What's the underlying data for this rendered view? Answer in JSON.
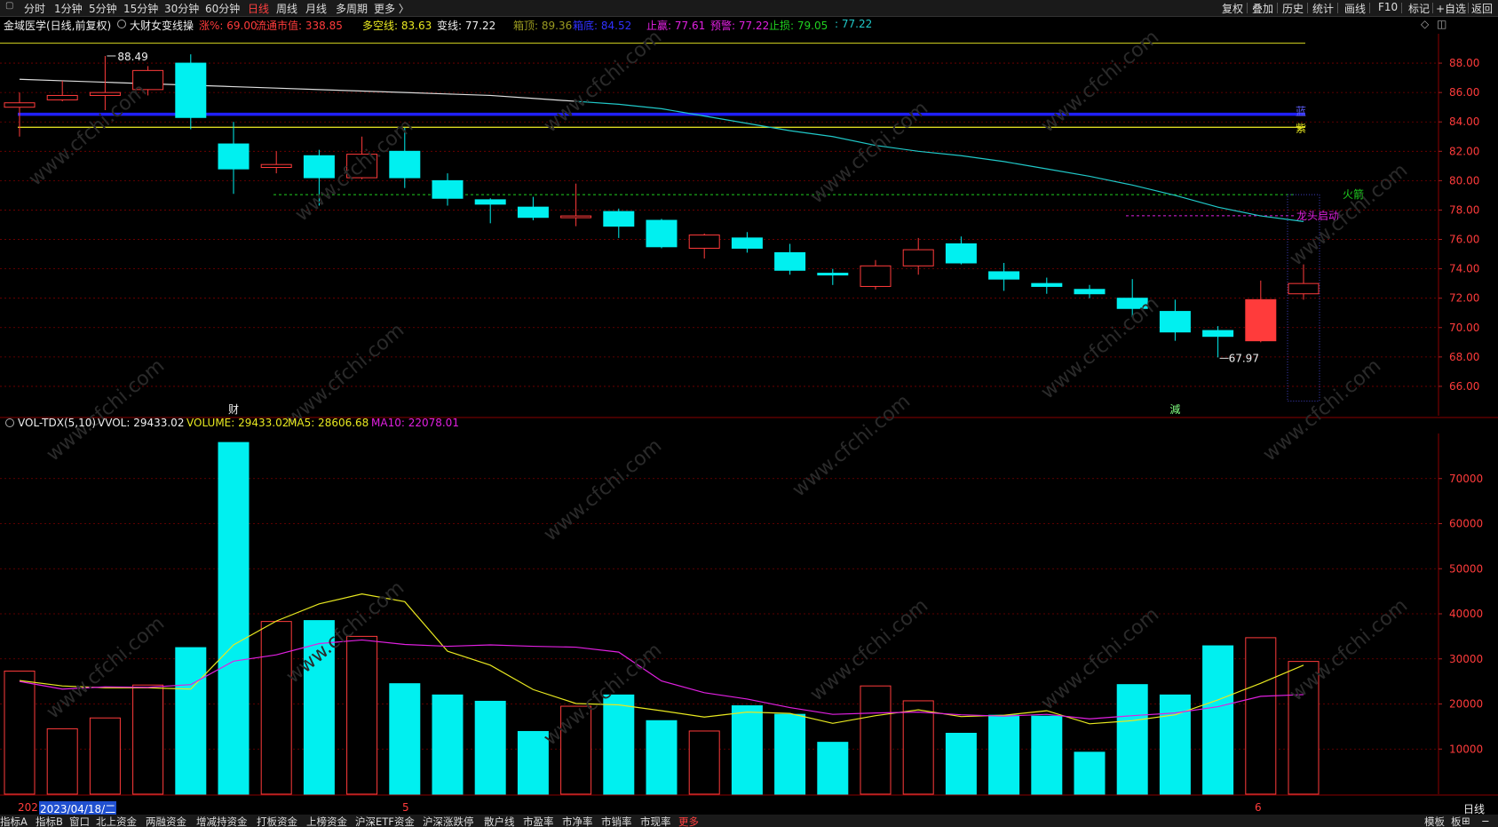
{
  "toolbar": {
    "tabs": [
      "分时",
      "1分钟",
      "5分钟",
      "15分钟",
      "30分钟",
      "60分钟",
      "日线",
      "周线",
      "月线",
      "多周期",
      "更多 〉"
    ],
    "active_tab": "日线",
    "right_buttons": [
      "复权",
      "叠加",
      "历史",
      "统计",
      "画线",
      "F10",
      "标记",
      "+自选",
      "返回"
    ]
  },
  "info": {
    "stock_name": "金域医学(日线,前复权)",
    "indicator_name": "大财女变线操",
    "pct_label": "涨%: 69.00",
    "float_cap_label": "流通市值: 338.85",
    "longshort_label": "多空线: 83.63",
    "change_label": "变线: 77.22",
    "box_top_label": "箱顶: 89.36",
    "box_bottom_label": "箱底: 84.52",
    "stop_profit_label": "止赢: 77.61",
    "warn_label": "预警: 77.22",
    "stop_loss_label": "止损: 79.05",
    "last_label": ": 77.22"
  },
  "colors": {
    "up": "#ff3b3b",
    "down": "#00f0f0",
    "box_bottom_line": "#2020ff",
    "longshort_line": "#d8d820",
    "ma_line": "#20c8c8",
    "ma5": "#e8e820",
    "ma10": "#e020e0",
    "grid_red": "#7a0000",
    "stop_loss_line": "#20d020",
    "warn_line": "#e020e0"
  },
  "price_axis": {
    "min": 64,
    "max": 90,
    "ticks": [
      "88.00",
      "86.00",
      "84.00",
      "82.00",
      "80.00",
      "78.00",
      "76.00",
      "74.00",
      "72.00",
      "70.00",
      "68.00",
      "66.00"
    ]
  },
  "candles": [
    {
      "o": 85.0,
      "c": 85.3,
      "h": 86.0,
      "l": 83.0
    },
    {
      "o": 85.5,
      "c": 85.8,
      "h": 86.8,
      "l": 85.4
    },
    {
      "o": 85.8,
      "c": 86.0,
      "h": 88.49,
      "l": 84.8
    },
    {
      "o": 86.2,
      "c": 87.5,
      "h": 87.8,
      "l": 85.8
    },
    {
      "o": 88.0,
      "c": 84.3,
      "h": 88.6,
      "l": 83.5
    },
    {
      "o": 82.5,
      "c": 80.8,
      "h": 84.0,
      "l": 79.1
    },
    {
      "o": 80.9,
      "c": 81.1,
      "h": 82.0,
      "l": 80.5
    },
    {
      "o": 81.7,
      "c": 80.2,
      "h": 82.1,
      "l": 78.3
    },
    {
      "o": 80.2,
      "c": 81.8,
      "h": 83.0,
      "l": 80.1
    },
    {
      "o": 82.0,
      "c": 80.2,
      "h": 83.6,
      "l": 79.5
    },
    {
      "o": 80.0,
      "c": 78.8,
      "h": 80.5,
      "l": 78.3
    },
    {
      "o": 78.7,
      "c": 78.4,
      "h": 78.8,
      "l": 77.1
    },
    {
      "o": 78.2,
      "c": 77.5,
      "h": 78.9,
      "l": 77.3
    },
    {
      "o": 77.5,
      "c": 77.6,
      "h": 79.8,
      "l": 76.9
    },
    {
      "o": 77.9,
      "c": 76.9,
      "h": 78.1,
      "l": 76.1
    },
    {
      "o": 77.3,
      "c": 75.5,
      "h": 77.4,
      "l": 75.4
    },
    {
      "o": 75.4,
      "c": 76.3,
      "h": 76.4,
      "l": 74.7
    },
    {
      "o": 76.1,
      "c": 75.4,
      "h": 76.5,
      "l": 75.1
    },
    {
      "o": 75.1,
      "c": 73.9,
      "h": 75.7,
      "l": 73.6
    },
    {
      "o": 73.7,
      "c": 73.6,
      "h": 74.0,
      "l": 72.9
    },
    {
      "o": 72.8,
      "c": 74.2,
      "h": 74.6,
      "l": 72.6
    },
    {
      "o": 74.2,
      "c": 75.3,
      "h": 76.1,
      "l": 73.6
    },
    {
      "o": 75.7,
      "c": 74.4,
      "h": 76.2,
      "l": 74.3
    },
    {
      "o": 73.8,
      "c": 73.3,
      "h": 74.4,
      "l": 72.5
    },
    {
      "o": 73.0,
      "c": 72.8,
      "h": 73.4,
      "l": 72.3
    },
    {
      "o": 72.6,
      "c": 72.3,
      "h": 72.9,
      "l": 72.0
    },
    {
      "o": 72.0,
      "c": 71.3,
      "h": 73.3,
      "l": 70.7
    },
    {
      "o": 71.1,
      "c": 69.7,
      "h": 71.9,
      "l": 69.1
    },
    {
      "o": 69.8,
      "c": 69.4,
      "h": 70.1,
      "l": 67.97
    },
    {
      "o": 69.1,
      "c": 71.9,
      "h": 73.2,
      "l": 69.0
    },
    {
      "o": 72.3,
      "c": 73.0,
      "h": 74.3,
      "l": 71.9
    }
  ],
  "red_filled_index": 29,
  "ma_line": [
    86.9,
    86.8,
    86.7,
    86.6,
    86.5,
    86.4,
    86.3,
    86.2,
    86.1,
    86.0,
    85.9,
    85.8,
    85.6,
    85.4,
    85.2,
    84.9,
    84.4,
    83.9,
    83.4,
    83.0,
    82.4,
    82.0,
    81.7,
    81.3,
    80.8,
    80.3,
    79.7,
    79.0,
    78.2,
    77.6,
    77.22
  ],
  "levels": {
    "box_bottom": 84.52,
    "longshort": 83.63,
    "stop_loss": 79.05,
    "warn": 77.61,
    "top_line": 89.36
  },
  "annotations": {
    "high_label": "88.49",
    "low_label": "67.97",
    "blue_line_label": "蓝",
    "yellow_line_label": "紫",
    "rocket_label": "火箭",
    "dragon_label": "龙头启动",
    "cai_label": "财",
    "jian_label": "減"
  },
  "vol_info": {
    "title": "VOL-TDX(5,10)",
    "vvol": "VVOL: 29433.02",
    "volume": "VOLUME: 29433.02",
    "ma5": "MA5: 28606.68",
    "ma10": "MA10: 22078.01"
  },
  "vol_axis": {
    "min": 0,
    "max": 80000,
    "ticks": [
      "70000",
      "60000",
      "50000",
      "40000",
      "30000",
      "20000",
      "10000"
    ]
  },
  "volumes": [
    27300,
    14500,
    16900,
    24200,
    32500,
    78000,
    38300,
    38500,
    35000,
    24500,
    22000,
    20600,
    13900,
    19500,
    22000,
    16300,
    14000,
    19600,
    17700,
    11500,
    24000,
    20700,
    13500,
    17500,
    17300,
    9300,
    24300,
    22000,
    32900,
    34700,
    29433
  ],
  "ma5": [
    25200,
    24000,
    23600,
    23600,
    23300,
    33100,
    38400,
    42200,
    44400,
    42700,
    31700,
    28600,
    23200,
    20100,
    19800,
    18500,
    17100,
    18200,
    17900,
    15700,
    17400,
    18700,
    17200,
    17500,
    18500,
    15600,
    16300,
    17600,
    20900,
    24600,
    28607
  ],
  "ma10": [
    25000,
    23300,
    23800,
    23700,
    24300,
    29500,
    30900,
    33400,
    34200,
    33200,
    32800,
    33100,
    32800,
    32600,
    31500,
    25100,
    22500,
    21100,
    19200,
    17700,
    18000,
    18200,
    17600,
    17300,
    17700,
    16700,
    17400,
    18000,
    19400,
    21700,
    22078
  ],
  "dates": {
    "left_fragment": "202",
    "selected": "2023/04/18/二",
    "mark5": "5",
    "mark6": "6"
  },
  "bottom_right_label": "日线",
  "bottom_tabs": [
    "指标A",
    "指标B",
    "窗口",
    "北上资金",
    "两融资金",
    "增减持资金",
    "打板资金",
    "上榜资金",
    "沪深ETF资金",
    "沪深涨跌停",
    "散户线",
    "市盈率",
    "市净率",
    "市销率",
    "市现率",
    "更多"
  ],
  "bottom_right": [
    "模板",
    "板"
  ],
  "watermark": "www.cfchi.com"
}
